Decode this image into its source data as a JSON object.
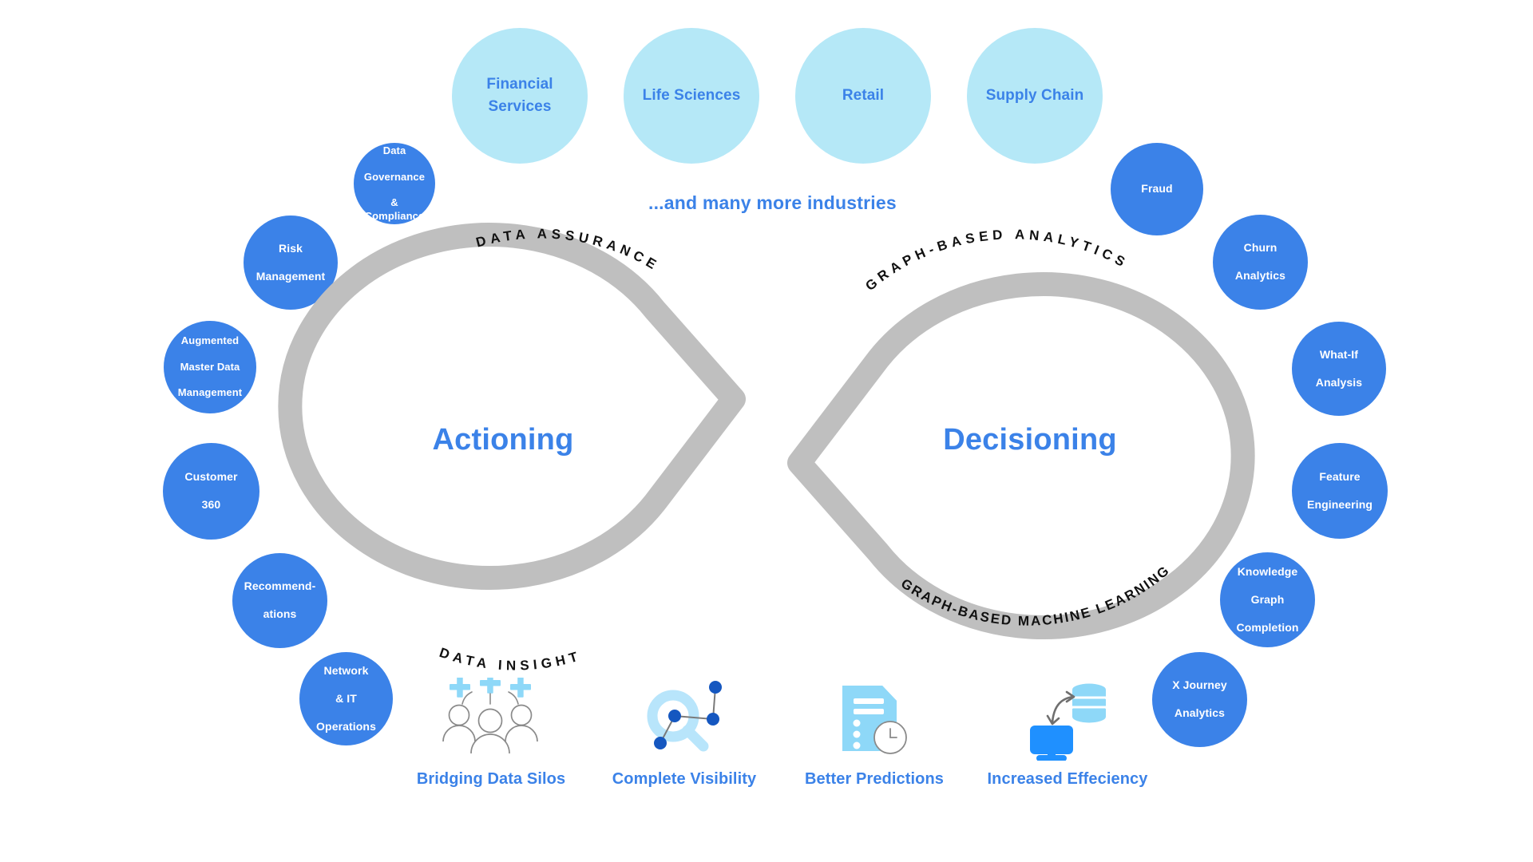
{
  "colors": {
    "primary_blue": "#3b82e8",
    "light_blue": "#b5e8f7",
    "ribbon_gray": "#bfbfbf",
    "icon_dark_blue": "#1557c0",
    "icon_light_blue": "#8ed8f8",
    "text_dark": "#111111"
  },
  "industries": {
    "tagline": "...and many more industries",
    "items": [
      {
        "label": "Financial Services",
        "line1": "Financial",
        "line2": "Services"
      },
      {
        "label": "Life Sciences",
        "line1": "Life Sciences",
        "line2": ""
      },
      {
        "label": "Retail",
        "line1": "Retail",
        "line2": ""
      },
      {
        "label": "Supply Chain",
        "line1": "Supply Chain",
        "line2": ""
      }
    ]
  },
  "loops": {
    "left": {
      "title": "Actioning",
      "top_arc": "DATA ASSURANCE",
      "bottom_arc": "DATA INSIGHT"
    },
    "right": {
      "title": "Decisioning",
      "top_arc": "GRAPH-BASED ANALYTICS",
      "bottom_arc": "GRAPH-BASED MACHINE LEARNING"
    }
  },
  "left_usecases": [
    {
      "name": "data-governance-compliance",
      "lines": [
        "Data",
        "Governance",
        "& Compliance"
      ]
    },
    {
      "name": "risk-management",
      "lines": [
        "Risk",
        "Management"
      ]
    },
    {
      "name": "augmented-master-data-management",
      "lines": [
        "Augmented",
        "Master Data",
        "Management"
      ]
    },
    {
      "name": "customer-360",
      "lines": [
        "Customer",
        "360"
      ]
    },
    {
      "name": "recommendations",
      "lines": [
        "Recommend-",
        "ations"
      ]
    },
    {
      "name": "network-it-operations",
      "lines": [
        "Network",
        "& IT",
        "Operations"
      ]
    }
  ],
  "right_usecases": [
    {
      "name": "fraud",
      "lines": [
        "Fraud"
      ]
    },
    {
      "name": "churn-analytics",
      "lines": [
        "Churn",
        "Analytics"
      ]
    },
    {
      "name": "what-if-analysis",
      "lines": [
        "What-If",
        "Analysis"
      ]
    },
    {
      "name": "feature-engineering",
      "lines": [
        "Feature",
        "Engineering"
      ]
    },
    {
      "name": "knowledge-graph-completion",
      "lines": [
        "Knowledge",
        "Graph",
        "Completion"
      ]
    },
    {
      "name": "x-journey-analytics",
      "lines": [
        "X Journey",
        "Analytics"
      ]
    }
  ],
  "benefits": [
    {
      "icon": "people-plus-icon",
      "label": "Bridging Data Silos"
    },
    {
      "icon": "magnifier-graph-icon",
      "label": "Complete Visibility"
    },
    {
      "icon": "document-clock-icon",
      "label": "Better Predictions"
    },
    {
      "icon": "monitor-database-icon",
      "label": "Increased Effeciency"
    }
  ]
}
